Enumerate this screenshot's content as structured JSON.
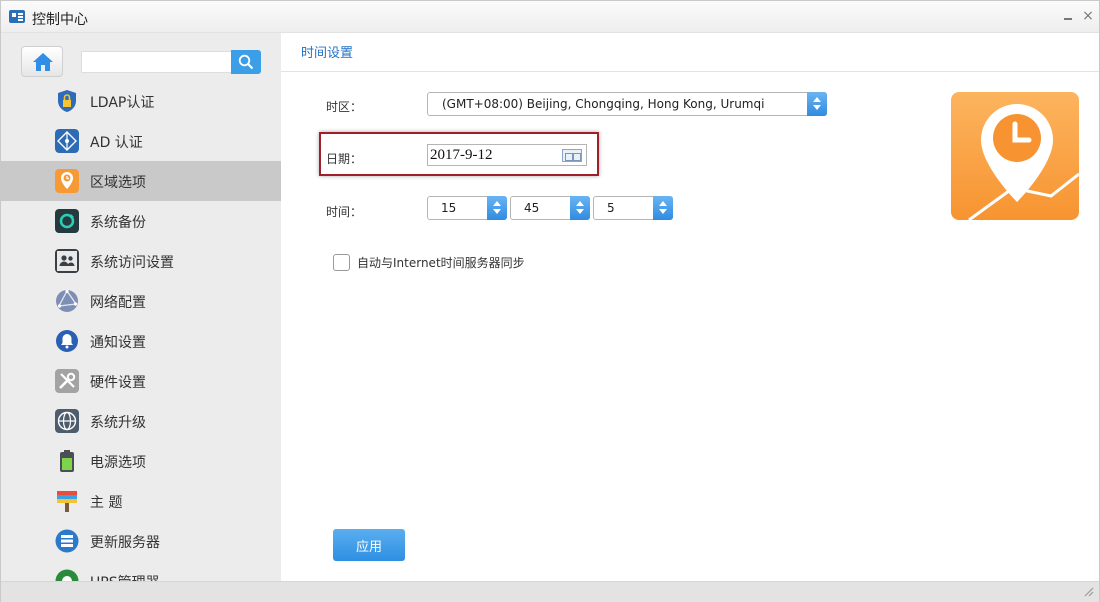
{
  "window": {
    "title": "控制中心"
  },
  "sidebar": {
    "search": {
      "value": "",
      "placeholder": ""
    },
    "items": [
      {
        "label": "LDAP认证",
        "icon": "lock-shield-icon",
        "active": false
      },
      {
        "label": "AD 认证",
        "icon": "network-diamond-icon",
        "active": false
      },
      {
        "label": "区域选项",
        "icon": "location-clock-icon",
        "active": true
      },
      {
        "label": "系统备份",
        "icon": "backup-sync-icon",
        "active": false
      },
      {
        "label": "系统访问设置",
        "icon": "users-access-icon",
        "active": false
      },
      {
        "label": "网络配置",
        "icon": "network-globe-icon",
        "active": false
      },
      {
        "label": "通知设置",
        "icon": "bell-icon",
        "active": false
      },
      {
        "label": "硬件设置",
        "icon": "tools-icon",
        "active": false
      },
      {
        "label": "系统升级",
        "icon": "upgrade-globe-icon",
        "active": false
      },
      {
        "label": "电源选项",
        "icon": "battery-icon",
        "active": false
      },
      {
        "label": "主 题",
        "icon": "paint-roller-icon",
        "active": false
      },
      {
        "label": "更新服务器",
        "icon": "update-server-icon",
        "active": false
      },
      {
        "label": "UPS管理器",
        "icon": "ups-icon",
        "active": false
      }
    ]
  },
  "main": {
    "title": "时间设置",
    "timezone": {
      "label": "时区：",
      "value": "(GMT+08:00) Beijing, Chongqing, Hong Kong, Urumqi"
    },
    "date": {
      "label": "日期：",
      "value": "2017-9-12"
    },
    "time": {
      "label": "时间：",
      "hour": "15",
      "minute": "45",
      "second": "5"
    },
    "sync": {
      "label": "自动与Internet时间服务器同步",
      "checked": false
    },
    "apply_label": "应用"
  },
  "colors": {
    "accent": "#3d9ee8",
    "title_blue": "#2673c8",
    "logo_orange": "#f79431",
    "highlight": "#a0202a"
  }
}
